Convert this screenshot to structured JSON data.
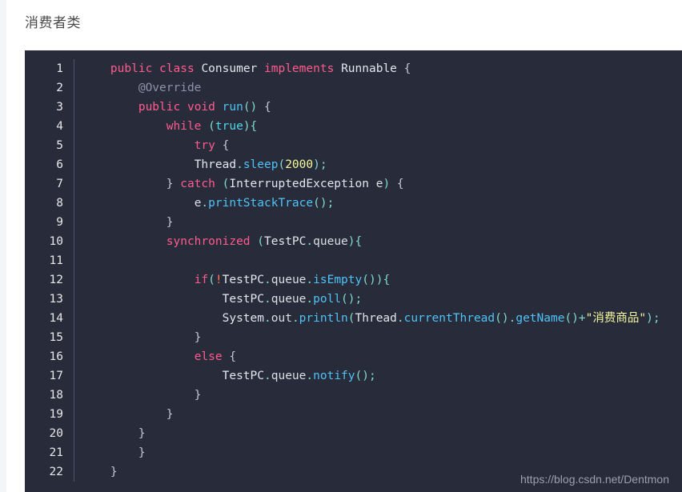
{
  "article": {
    "title": "消费者类"
  },
  "watermark": {
    "text": "https://blog.csdn.net/Dentmon"
  },
  "code_block": {
    "language": "java",
    "theme": {
      "background": "#282c3a",
      "foreground": "#dcdfe4",
      "line_number_color": "#e8e8e8",
      "gutter_divider": "#4d5366",
      "keyword": "#ff5c8d",
      "function": "#4fc3f7",
      "literal": "#4fd7e8",
      "number": "#f3f99d",
      "string": "#f3f99d",
      "annotation": "#8a93a8",
      "operator": "#7fdbca",
      "negation": "#ff7a59"
    },
    "first_line_number": 1,
    "total_lines": 22,
    "lines": [
      {
        "n": "1",
        "text": "public class Consumer implements Runnable {"
      },
      {
        "n": "2",
        "text": "    @Override"
      },
      {
        "n": "3",
        "text": "    public void run() {"
      },
      {
        "n": "4",
        "text": "        while (true){"
      },
      {
        "n": "5",
        "text": "            try {"
      },
      {
        "n": "6",
        "text": "            Thread.sleep(2000);"
      },
      {
        "n": "7",
        "text": "        } catch (InterruptedException e) {"
      },
      {
        "n": "8",
        "text": "            e.printStackTrace();"
      },
      {
        "n": "9",
        "text": "        }"
      },
      {
        "n": "10",
        "text": "        synchronized (TestPC.queue){"
      },
      {
        "n": "11",
        "text": ""
      },
      {
        "n": "12",
        "text": "            if(!TestPC.queue.isEmpty()){"
      },
      {
        "n": "13",
        "text": "                TestPC.queue.poll();"
      },
      {
        "n": "14",
        "text": "                System.out.println(Thread.currentThread().getName()+\"消费商品\");"
      },
      {
        "n": "15",
        "text": "            }"
      },
      {
        "n": "16",
        "text": "            else {"
      },
      {
        "n": "17",
        "text": "                TestPC.queue.notify();"
      },
      {
        "n": "18",
        "text": "            }"
      },
      {
        "n": "19",
        "text": "        }"
      },
      {
        "n": "20",
        "text": "    }"
      },
      {
        "n": "21",
        "text": "    }"
      },
      {
        "n": "22",
        "text": "}"
      }
    ],
    "tokens": [
      [
        [
          "    ",
          "t-plain"
        ],
        [
          "public",
          "t-kw"
        ],
        [
          " ",
          "t-plain"
        ],
        [
          "class",
          "t-kw"
        ],
        [
          " ",
          "t-plain"
        ],
        [
          "Consumer",
          "t-type"
        ],
        [
          " ",
          "t-plain"
        ],
        [
          "implements",
          "t-kw"
        ],
        [
          " ",
          "t-plain"
        ],
        [
          "Runnable",
          "t-type"
        ],
        [
          " ",
          "t-plain"
        ],
        [
          "{",
          "t-brace"
        ]
      ],
      [
        [
          "        ",
          "t-plain"
        ],
        [
          "@Override",
          "t-anno"
        ]
      ],
      [
        [
          "        ",
          "t-plain"
        ],
        [
          "public",
          "t-kw"
        ],
        [
          " ",
          "t-plain"
        ],
        [
          "void",
          "t-kw"
        ],
        [
          " ",
          "t-plain"
        ],
        [
          "run",
          "t-fn"
        ],
        [
          "()",
          "t-op"
        ],
        [
          " ",
          "t-plain"
        ],
        [
          "{",
          "t-brace"
        ]
      ],
      [
        [
          "            ",
          "t-plain"
        ],
        [
          "while",
          "t-kw"
        ],
        [
          " ",
          "t-plain"
        ],
        [
          "(",
          "t-op"
        ],
        [
          "true",
          "t-lit"
        ],
        [
          "){",
          "t-op"
        ]
      ],
      [
        [
          "                ",
          "t-plain"
        ],
        [
          "try",
          "t-kw"
        ],
        [
          " ",
          "t-plain"
        ],
        [
          "{",
          "t-brace"
        ]
      ],
      [
        [
          "                ",
          "t-plain"
        ],
        [
          "Thread",
          "t-type"
        ],
        [
          ".",
          "t-op"
        ],
        [
          "sleep",
          "t-fn"
        ],
        [
          "(",
          "t-op"
        ],
        [
          "2000",
          "t-num"
        ],
        [
          ");",
          "t-op"
        ]
      ],
      [
        [
          "            ",
          "t-plain"
        ],
        [
          "}",
          "t-brace"
        ],
        [
          " ",
          "t-plain"
        ],
        [
          "catch",
          "t-kw"
        ],
        [
          " ",
          "t-plain"
        ],
        [
          "(",
          "t-op"
        ],
        [
          "InterruptedException",
          "t-type"
        ],
        [
          " ",
          "t-plain"
        ],
        [
          "e",
          "t-plain"
        ],
        [
          ")",
          "t-op"
        ],
        [
          " ",
          "t-plain"
        ],
        [
          "{",
          "t-brace"
        ]
      ],
      [
        [
          "                ",
          "t-plain"
        ],
        [
          "e",
          "t-plain"
        ],
        [
          ".",
          "t-op"
        ],
        [
          "printStackTrace",
          "t-fn"
        ],
        [
          "();",
          "t-op"
        ]
      ],
      [
        [
          "            ",
          "t-plain"
        ],
        [
          "}",
          "t-brace"
        ]
      ],
      [
        [
          "            ",
          "t-plain"
        ],
        [
          "synchronized",
          "t-kw"
        ],
        [
          " ",
          "t-plain"
        ],
        [
          "(",
          "t-op"
        ],
        [
          "TestPC",
          "t-type"
        ],
        [
          ".",
          "t-op"
        ],
        [
          "queue",
          "t-plain"
        ],
        [
          "){",
          "t-op"
        ]
      ],
      [
        [
          "",
          ""
        ]
      ],
      [
        [
          "                ",
          "t-plain"
        ],
        [
          "if",
          "t-kw"
        ],
        [
          "(",
          "t-op"
        ],
        [
          "!",
          "t-bang"
        ],
        [
          "TestPC",
          "t-type"
        ],
        [
          ".",
          "t-op"
        ],
        [
          "queue",
          "t-plain"
        ],
        [
          ".",
          "t-op"
        ],
        [
          "isEmpty",
          "t-fn"
        ],
        [
          "()){",
          "t-op"
        ]
      ],
      [
        [
          "                    ",
          "t-plain"
        ],
        [
          "TestPC",
          "t-type"
        ],
        [
          ".",
          "t-op"
        ],
        [
          "queue",
          "t-plain"
        ],
        [
          ".",
          "t-op"
        ],
        [
          "poll",
          "t-fn"
        ],
        [
          "();",
          "t-op"
        ]
      ],
      [
        [
          "                    ",
          "t-plain"
        ],
        [
          "System",
          "t-type"
        ],
        [
          ".",
          "t-op"
        ],
        [
          "out",
          "t-plain"
        ],
        [
          ".",
          "t-op"
        ],
        [
          "println",
          "t-fn"
        ],
        [
          "(",
          "t-op"
        ],
        [
          "Thread",
          "t-type"
        ],
        [
          ".",
          "t-op"
        ],
        [
          "currentThread",
          "t-fn"
        ],
        [
          "()",
          "t-op"
        ],
        [
          ".",
          "t-op"
        ],
        [
          "getName",
          "t-fn"
        ],
        [
          "()",
          "t-op"
        ],
        [
          "+",
          "t-op"
        ],
        [
          "\"消费商品\"",
          "t-str"
        ],
        [
          ");",
          "t-op"
        ]
      ],
      [
        [
          "                ",
          "t-plain"
        ],
        [
          "}",
          "t-brace"
        ]
      ],
      [
        [
          "                ",
          "t-plain"
        ],
        [
          "else",
          "t-kw"
        ],
        [
          " ",
          "t-plain"
        ],
        [
          "{",
          "t-brace"
        ]
      ],
      [
        [
          "                    ",
          "t-plain"
        ],
        [
          "TestPC",
          "t-type"
        ],
        [
          ".",
          "t-op"
        ],
        [
          "queue",
          "t-plain"
        ],
        [
          ".",
          "t-op"
        ],
        [
          "notify",
          "t-fn"
        ],
        [
          "();",
          "t-op"
        ]
      ],
      [
        [
          "                ",
          "t-plain"
        ],
        [
          "}",
          "t-brace"
        ]
      ],
      [
        [
          "            ",
          "t-plain"
        ],
        [
          "}",
          "t-brace"
        ]
      ],
      [
        [
          "        ",
          "t-plain"
        ],
        [
          "}",
          "t-brace"
        ]
      ],
      [
        [
          "        ",
          "t-plain"
        ],
        [
          "}",
          "t-brace"
        ]
      ],
      [
        [
          "    ",
          "t-plain"
        ],
        [
          "}",
          "t-brace"
        ]
      ]
    ]
  }
}
